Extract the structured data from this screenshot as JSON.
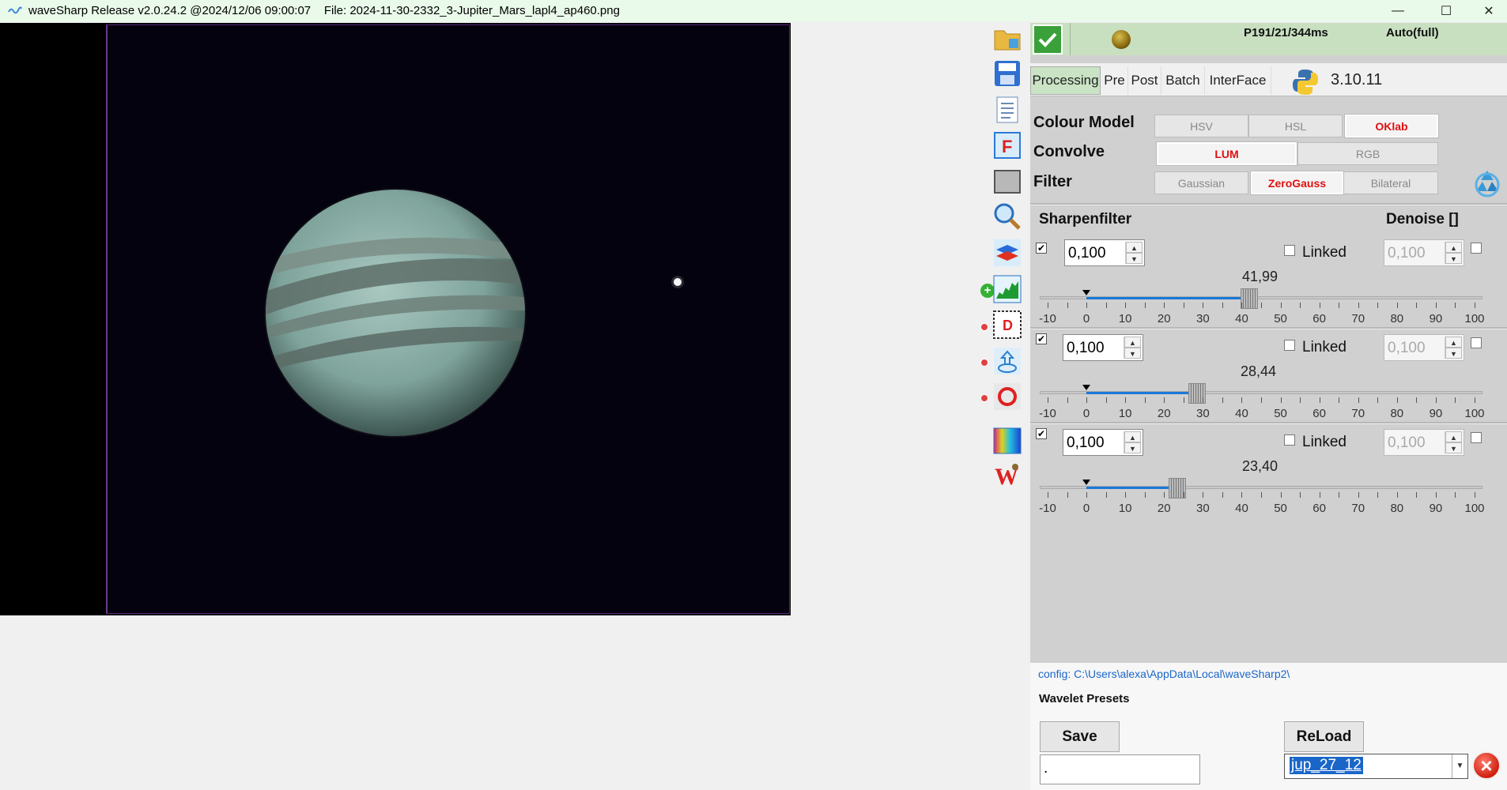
{
  "window": {
    "title": "waveSharp Release v2.0.24.2 @2024/12/06 09:00:07    File: 2024-11-30-2332_3-Jupiter_Mars_lapl4_ap460.png",
    "minimize": "—",
    "maximize": "☐",
    "close": "✕"
  },
  "status": {
    "ok_icon": "check-icon",
    "frame_info": "P191/21/344ms",
    "mode": "Auto(full)"
  },
  "tabs": [
    {
      "label": "Processing",
      "active": true
    },
    {
      "label": "Pre"
    },
    {
      "label": "Post"
    },
    {
      "label": "Batch"
    },
    {
      "label": "InterFace"
    }
  ],
  "python_version": "3.10.11",
  "options": {
    "colour_model": {
      "label": "Colour Model",
      "choices": [
        "HSV",
        "HSL",
        "OKlab"
      ],
      "selected": "OKlab"
    },
    "convolve": {
      "label": "Convolve",
      "choices": [
        "LUM",
        "RGB"
      ],
      "selected": "LUM"
    },
    "filter": {
      "label": "Filter",
      "choices": [
        "Gaussian",
        "ZeroGauss",
        "Bilateral"
      ],
      "selected": "ZeroGauss"
    }
  },
  "sharpen": {
    "title": "Sharpenfilter",
    "denoise_title": "Denoise []",
    "layers": [
      {
        "enabled": true,
        "value": "0,100",
        "linked_label": "Linked",
        "linked": false,
        "denoise": "0,100",
        "slider_value": 41.99,
        "slider_text": "41,99"
      },
      {
        "enabled": true,
        "value": "0,100",
        "linked_label": "Linked",
        "linked": false,
        "denoise": "0,100",
        "slider_value": 28.44,
        "slider_text": "28,44"
      },
      {
        "enabled": true,
        "value": "0,100",
        "linked_label": "Linked",
        "linked": false,
        "denoise": "0,100",
        "slider_value": 23.4,
        "slider_text": "23,40"
      }
    ],
    "scale": {
      "min": -10,
      "max": 100,
      "labels": [
        "-10",
        "0",
        "10",
        "20",
        "30",
        "40",
        "50",
        "60",
        "70",
        "80",
        "90",
        "100"
      ]
    }
  },
  "config": "config: C:\\Users\\alexa\\AppData\\Local\\waveSharp2\\",
  "presets": {
    "title": "Wavelet Presets",
    "save_label": "Save",
    "reload_label": "ReLoad",
    "save_name": ".",
    "selected_preset": "jup_27_12"
  },
  "toolbar_icons": [
    "open-folder-icon",
    "save-icon",
    "notes-icon",
    "frame-icon",
    "gray-square-icon",
    "zoom-icon",
    "layers-icon",
    "histogram-icon",
    "derotate-icon",
    "upload-icon",
    "ring-icon",
    "color-icon",
    "wavesharp-logo-icon"
  ],
  "colors": {
    "accent_selected": "#e01010",
    "slider_fill": "#1a78d8",
    "status_bg": "#c8e0c0"
  }
}
